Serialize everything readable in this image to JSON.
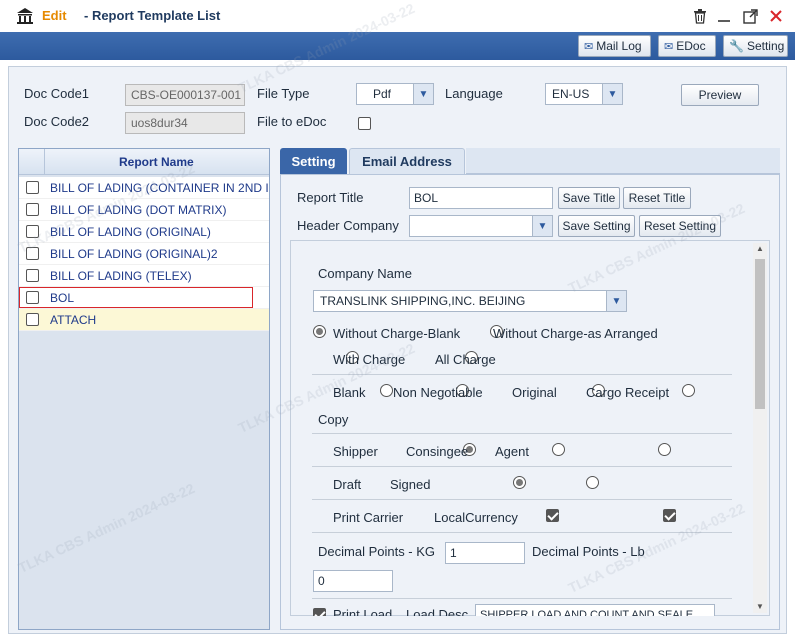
{
  "window": {
    "edit_label": "Edit",
    "title": "- Report Template List"
  },
  "toolbar": {
    "mail_log": "Mail Log",
    "edoc": "EDoc",
    "setting": "Setting"
  },
  "form": {
    "doc_code1_label": "Doc Code1",
    "doc_code1_value": "CBS-OE000137-001",
    "doc_code2_label": "Doc Code2",
    "doc_code2_value": "uos8dur34",
    "file_type_label": "File Type",
    "file_type_value": "Pdf",
    "file_to_edoc_label": "File to eDoc",
    "language_label": "Language",
    "language_value": "EN-US",
    "preview_button": "Preview"
  },
  "grid": {
    "header": "Report Name",
    "rows": [
      {
        "name": "BILL OF LADING (CONTAINER IN 2ND I"
      },
      {
        "name": "BILL OF LADING (DOT MATRIX)"
      },
      {
        "name": "BILL OF LADING (ORIGINAL)"
      },
      {
        "name": "BILL OF LADING (ORIGINAL)2"
      },
      {
        "name": "BILL OF LADING (TELEX)"
      },
      {
        "name": "BOL"
      },
      {
        "name": "ATTACH"
      }
    ]
  },
  "tabs": {
    "setting": "Setting",
    "email": "Email Address"
  },
  "setting": {
    "report_title_label": "Report Title",
    "report_title_value": "BOL",
    "save_title": "Save Title",
    "reset_title": "Reset Title",
    "header_company_label": "Header Company",
    "save_setting": "Save Setting",
    "reset_setting": "Reset Setting",
    "company_name_label": "Company Name",
    "company_name_value": "TRANSLINK SHIPPING,INC. BEIJING",
    "charge_options": [
      "Without Charge-Blank",
      "Without Charge-as Arranged",
      "With Charge",
      "All Charge"
    ],
    "doc_options": [
      "Blank",
      "Non Negotiable",
      "Original",
      "Cargo Receipt",
      "Copy"
    ],
    "party_options": [
      "Shipper",
      "Consingee",
      "Agent"
    ],
    "status_options": [
      "Draft",
      "Signed"
    ],
    "print_carrier": "Print Carrier",
    "local_currency": "LocalCurrency",
    "decimal_kg_label": "Decimal Points - KG",
    "decimal_kg_value": "1",
    "decimal_lb_label": "Decimal Points - Lb",
    "decimal_lb_value": "0",
    "print_load": "Print Load",
    "load_desc_label": "Load Desc",
    "load_desc_value": "SHIPPER LOAD AND COUNT AND SEALE"
  },
  "watermark": "TLKA CBS Admin 2024-03-22",
  "colors": {
    "toolbar_blue": "#2d5a9e",
    "edit_orange": "#e68a00",
    "close_red": "#d9262b"
  }
}
